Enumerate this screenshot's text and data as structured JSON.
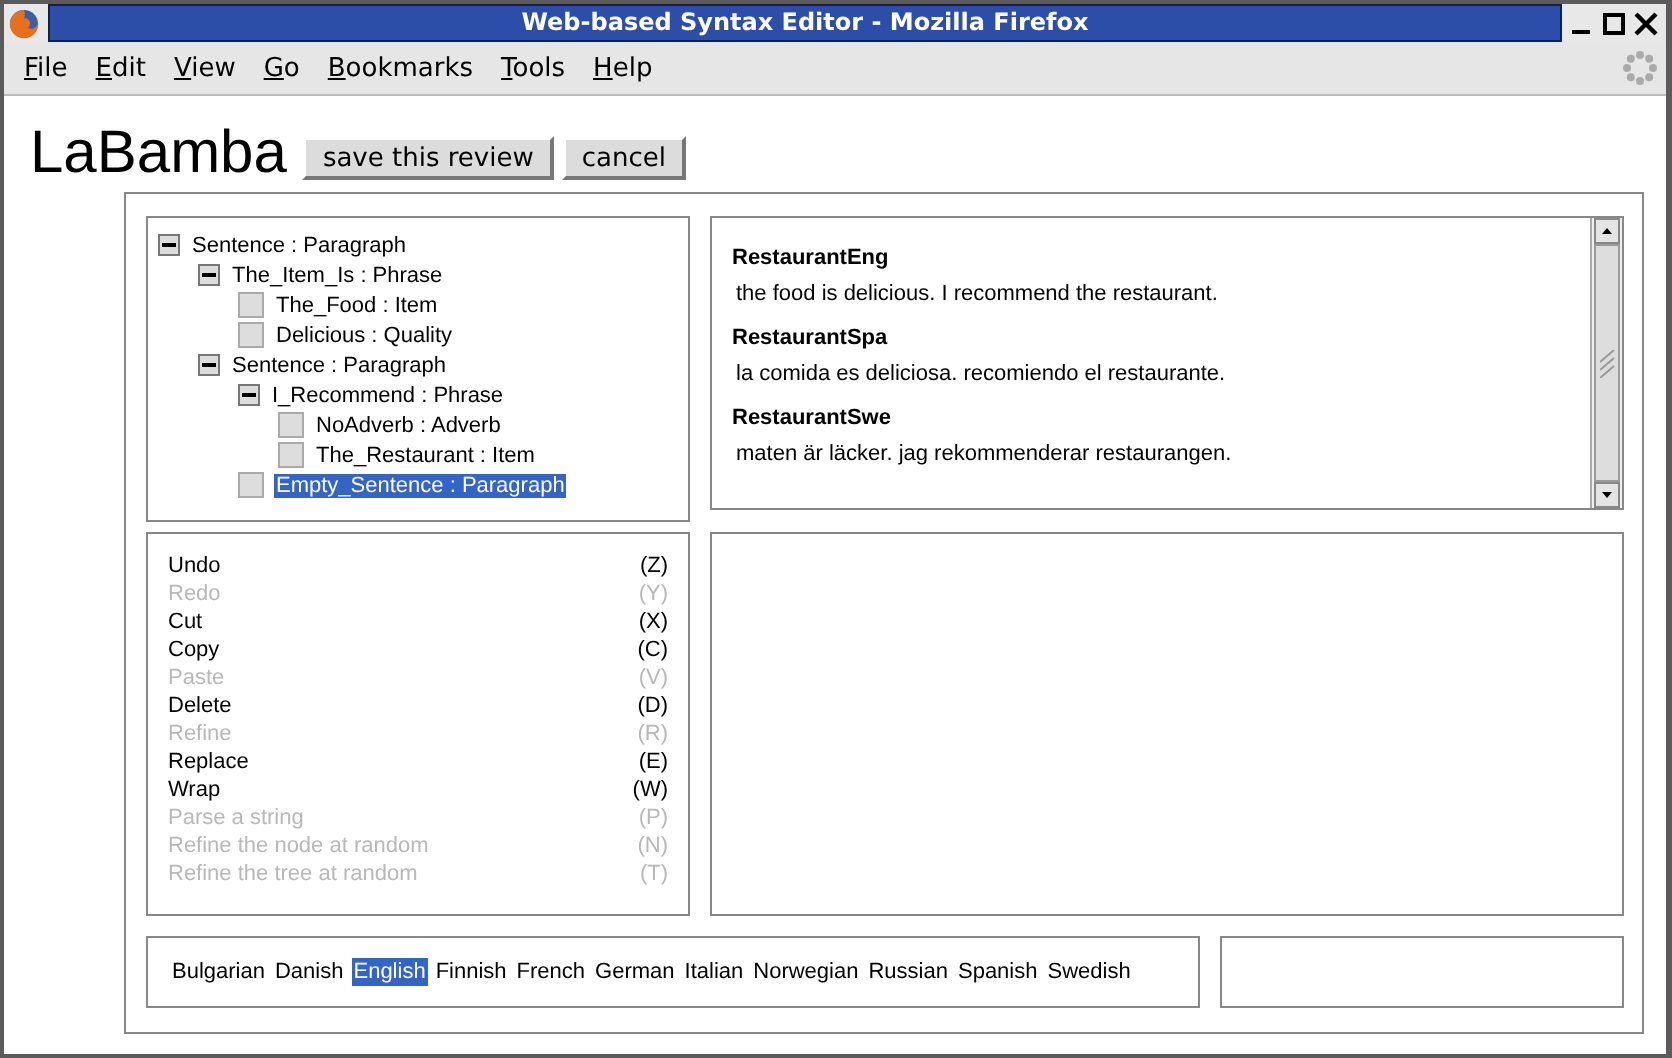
{
  "window": {
    "title": "Web-based Syntax Editor - Mozilla Firefox"
  },
  "menu": [
    "File",
    "Edit",
    "View",
    "Go",
    "Bookmarks",
    "Tools",
    "Help"
  ],
  "page_title": "LaBamba",
  "buttons": [
    "save this review",
    "cancel"
  ],
  "tree": [
    {
      "label": "Sentence : Paragraph",
      "expanded": true,
      "selected": false,
      "children": [
        {
          "label": "The_Item_Is : Phrase",
          "expanded": true,
          "selected": false,
          "children": [
            {
              "label": "The_Food : Item",
              "selected": false
            },
            {
              "label": "Delicious : Quality",
              "selected": false
            }
          ]
        },
        {
          "label": "Sentence : Paragraph",
          "expanded": true,
          "selected": false,
          "children": [
            {
              "label": "I_Recommend : Phrase",
              "expanded": true,
              "selected": false,
              "children": [
                {
                  "label": "NoAdverb : Adverb",
                  "selected": false
                },
                {
                  "label": "The_Restaurant : Item",
                  "selected": false
                }
              ]
            },
            {
              "label": "Empty_Sentence : Paragraph",
              "selected": true
            }
          ]
        }
      ]
    }
  ],
  "linearizations": [
    {
      "name": "RestaurantEng",
      "text": "the food is delicious.  I recommend the restaurant."
    },
    {
      "name": "RestaurantSpa",
      "text": "la comida es deliciosa.  recomiendo el restaurante."
    },
    {
      "name": "RestaurantSwe",
      "text": "maten är läcker.  jag rekommenderar restaurangen."
    }
  ],
  "commands": [
    {
      "label": "Undo",
      "key": "(Z)",
      "disabled": false
    },
    {
      "label": "Redo",
      "key": "(Y)",
      "disabled": true
    },
    {
      "label": "Cut",
      "key": "(X)",
      "disabled": false
    },
    {
      "label": "Copy",
      "key": "(C)",
      "disabled": false
    },
    {
      "label": "Paste",
      "key": "(V)",
      "disabled": true
    },
    {
      "label": "Delete",
      "key": "(D)",
      "disabled": false
    },
    {
      "label": "Refine",
      "key": "(R)",
      "disabled": true
    },
    {
      "label": "Replace",
      "key": "(E)",
      "disabled": false
    },
    {
      "label": "Wrap",
      "key": "(W)",
      "disabled": false
    },
    {
      "label": "Parse a string",
      "key": "(P)",
      "disabled": true
    },
    {
      "label": "Refine the node at random",
      "key": "(N)",
      "disabled": true
    },
    {
      "label": "Refine the tree at random",
      "key": "(T)",
      "disabled": true
    }
  ],
  "languages": [
    {
      "name": "Bulgarian",
      "selected": false
    },
    {
      "name": "Danish",
      "selected": false
    },
    {
      "name": "English",
      "selected": true
    },
    {
      "name": "Finnish",
      "selected": false
    },
    {
      "name": "French",
      "selected": false
    },
    {
      "name": "German",
      "selected": false
    },
    {
      "name": "Italian",
      "selected": false
    },
    {
      "name": "Norwegian",
      "selected": false
    },
    {
      "name": "Russian",
      "selected": false
    },
    {
      "name": "Spanish",
      "selected": false
    },
    {
      "name": "Swedish",
      "selected": false
    }
  ]
}
